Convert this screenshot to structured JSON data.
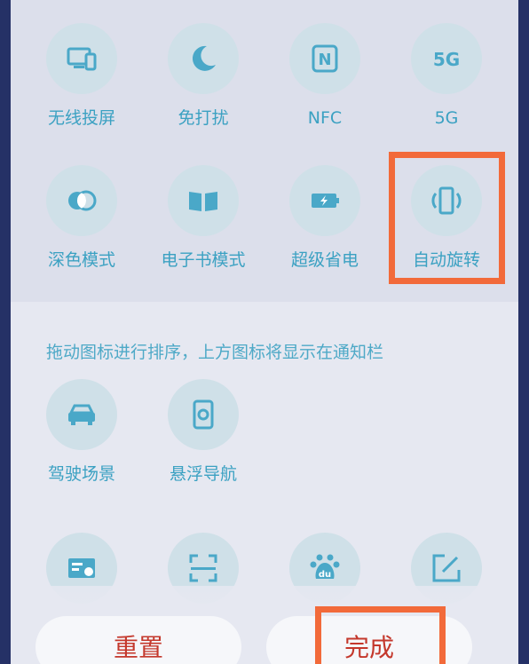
{
  "colors": {
    "frame": "#253166",
    "panel": "#e6e8f1",
    "section": "#dcdfeb",
    "tile_bg": "#cfe0e8",
    "icon": "#4aa8c8",
    "label": "#3ba1c2",
    "button_text": "#c4382c",
    "highlight": "#f26a3a"
  },
  "active_tiles": [
    {
      "name": "cast",
      "label": "无线投屏",
      "icon": "screen-cast-icon"
    },
    {
      "name": "dnd",
      "label": "免打扰",
      "icon": "moon-icon"
    },
    {
      "name": "nfc",
      "label": "NFC",
      "icon": "nfc-icon",
      "icon_text": "N"
    },
    {
      "name": "5g",
      "label": "5G",
      "icon": "5g-icon",
      "icon_text": "5G"
    },
    {
      "name": "dark",
      "label": "深色模式",
      "icon": "dark-mode-icon"
    },
    {
      "name": "ebook",
      "label": "电子书模式",
      "icon": "book-icon"
    },
    {
      "name": "power-saver",
      "label": "超级省电",
      "icon": "battery-icon"
    },
    {
      "name": "rotate",
      "label": "自动旋转",
      "icon": "rotate-icon"
    }
  ],
  "hint": "拖动图标进行排序，上方图标将显示在通知栏",
  "inactive_tiles": [
    {
      "name": "driving",
      "label": "驾驶场景",
      "icon": "car-icon"
    },
    {
      "name": "float-nav",
      "label": "悬浮导航",
      "icon": "floating-nav-icon"
    },
    {
      "name": "card",
      "icon": "card-icon"
    },
    {
      "name": "scan",
      "icon": "scan-icon"
    },
    {
      "name": "baidu",
      "icon": "baidu-paw-icon",
      "icon_text": "du"
    },
    {
      "name": "note",
      "icon": "edit-icon"
    }
  ],
  "buttons": {
    "reset": "重置",
    "done": "完成"
  }
}
